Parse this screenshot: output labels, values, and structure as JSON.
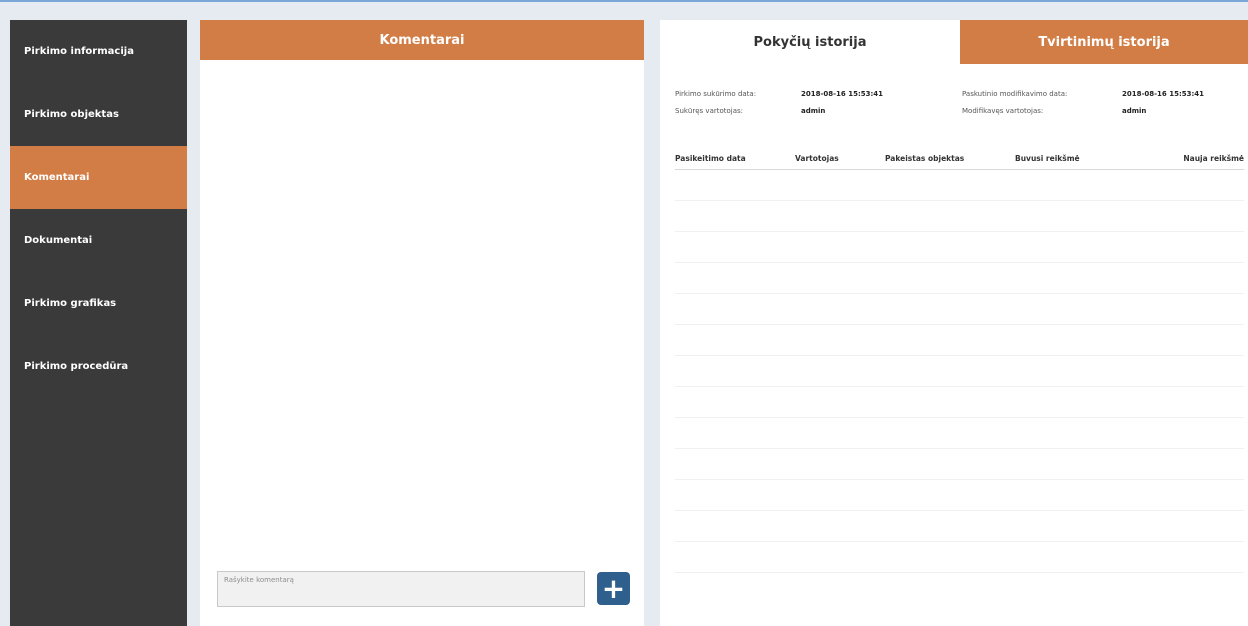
{
  "sidebar": {
    "items": [
      {
        "label": "Pirkimo informacija"
      },
      {
        "label": "Pirkimo objektas"
      },
      {
        "label": "Komentarai"
      },
      {
        "label": "Dokumentai"
      },
      {
        "label": "Pirkimo grafikas"
      },
      {
        "label": "Pirkimo procedūra"
      }
    ],
    "active_index": 2
  },
  "comments": {
    "header": "Komentarai",
    "input_placeholder": "Rašykite komentarą",
    "add_button_label": "+"
  },
  "history": {
    "tabs": [
      {
        "label": "Pokyčių istorija"
      },
      {
        "label": "Tvirtinimų istorija"
      }
    ],
    "meta": {
      "created_label": "Pirkimo sukūrimo data:",
      "created_value": "2018-08-16 15:53:41",
      "creator_label": "Sukūręs vartotojas:",
      "creator_value": "admin",
      "modified_label": "Paskutinio modifikavimo data:",
      "modified_value": "2018-08-16 15:53:41",
      "modifier_label": "Modifikavęs vartotojas:",
      "modifier_value": "admin"
    },
    "columns": [
      "Pasikeitimo data",
      "Vartotojas",
      "Pakeistas objektas",
      "Buvusi reikšmė",
      "Nauja reikšmė"
    ],
    "rows": []
  },
  "colors": {
    "accent": "#d27d45",
    "sidebar_bg": "#3a3a3a",
    "button_blue": "#2f5f8c",
    "page_bg": "#e6ebf1"
  }
}
